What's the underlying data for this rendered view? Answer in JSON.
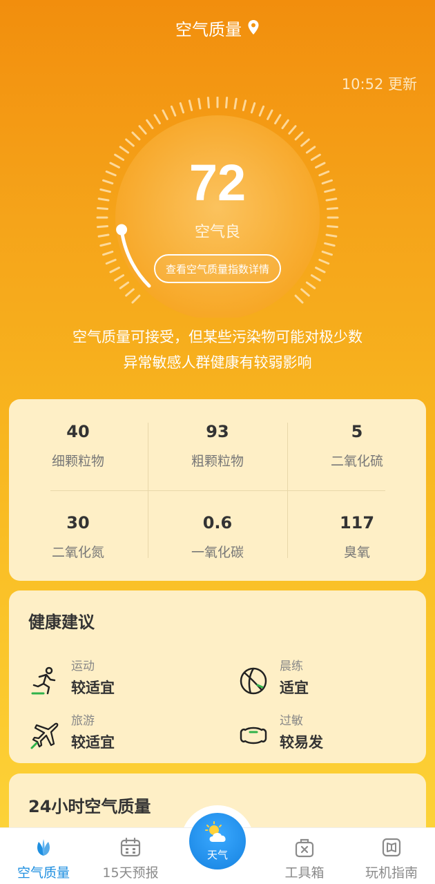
{
  "header": {
    "title": "空气质量"
  },
  "update_time": "10:52 更新",
  "aqi": {
    "value": "72",
    "level": "空气良",
    "detail_button": "查看空气质量指数详情",
    "progress_fraction": 0.14
  },
  "description": [
    "空气质量可接受，但某些污染物可能对极少数",
    "异常敏感人群健康有较弱影响"
  ],
  "pollutants": [
    {
      "value": "40",
      "name": "细颗粒物"
    },
    {
      "value": "93",
      "name": "粗颗粒物"
    },
    {
      "value": "5",
      "name": "二氧化硫"
    },
    {
      "value": "30",
      "name": "二氧化氮"
    },
    {
      "value": "0.6",
      "name": "一氧化碳"
    },
    {
      "value": "117",
      "name": "臭氧"
    }
  ],
  "health": {
    "title": "健康建议",
    "items": [
      {
        "key": "运动",
        "status": "较适宜",
        "icon": "running-icon"
      },
      {
        "key": "晨练",
        "status": "适宜",
        "icon": "ball-icon"
      },
      {
        "key": "旅游",
        "status": "较适宜",
        "icon": "airplane-icon"
      },
      {
        "key": "过敏",
        "status": "较易发",
        "icon": "mask-icon"
      }
    ]
  },
  "hourly": {
    "title": "24小时空气质量"
  },
  "tabs": [
    {
      "label": "空气质量",
      "icon": "leaf-icon",
      "active": true
    },
    {
      "label": "15天预报",
      "icon": "calendar-icon",
      "active": false
    },
    {
      "label": "天气",
      "icon": "weather-icon",
      "active": false
    },
    {
      "label": "工具箱",
      "icon": "toolbox-icon",
      "active": false
    },
    {
      "label": "玩机指南",
      "icon": "guide-icon",
      "active": false
    }
  ],
  "colors": {
    "accent": "#1f8fe0",
    "card": "#feefc6",
    "orange_top": "#f28e0d",
    "yellow_bottom": "#fdd63c"
  }
}
